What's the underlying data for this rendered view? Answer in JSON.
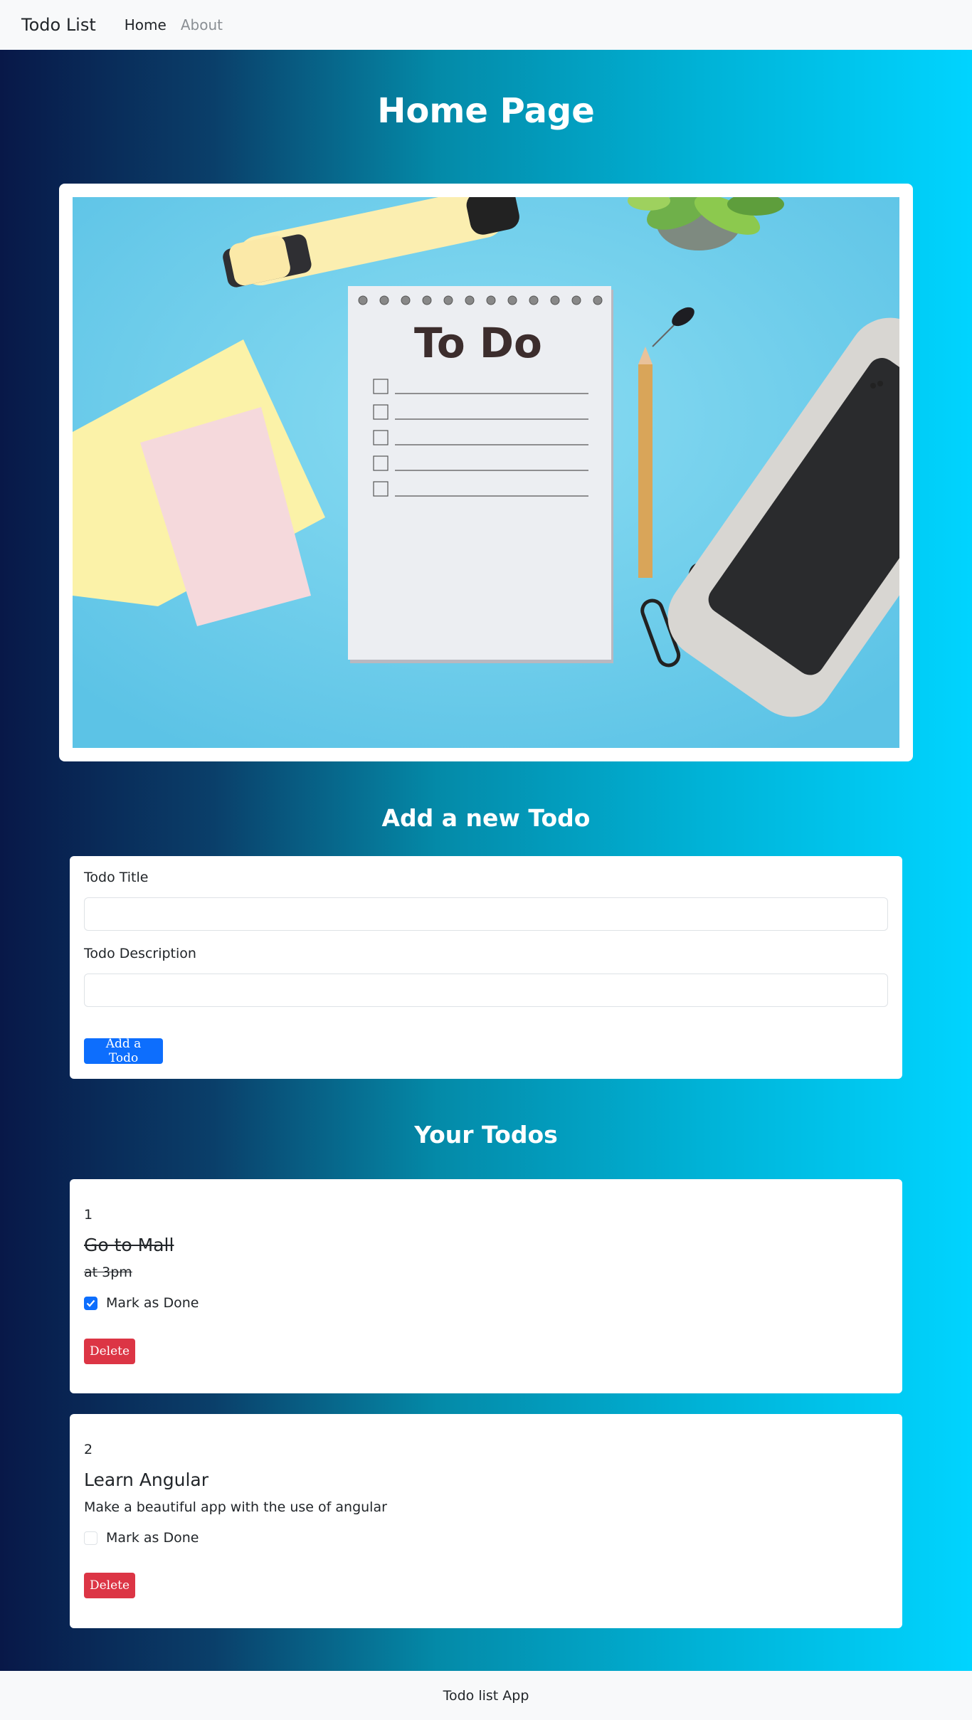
{
  "navbar": {
    "brand": "Todo List",
    "links": [
      "Home",
      "About"
    ]
  },
  "page": {
    "title": "Home Page",
    "hero_image": {
      "description_icon": "todo-notepad-image",
      "notepad_heading": "To Do"
    }
  },
  "add_form": {
    "section_title": "Add a new Todo",
    "title_label": "Todo Title",
    "title_value": "",
    "description_label": "Todo Description",
    "description_value": "",
    "submit_label": "Add a Todo"
  },
  "todos_section": {
    "title": "Your Todos",
    "items": [
      {
        "number": "1",
        "title": "Go to Mall",
        "description": "at 3pm",
        "done": true,
        "done_label": "Mark as Done",
        "delete_label": "Delete"
      },
      {
        "number": "2",
        "title": "Learn Angular",
        "description": "Make a beautiful app with the use of angular",
        "done": false,
        "done_label": "Mark as Done",
        "delete_label": "Delete"
      }
    ]
  },
  "footer": {
    "text": "Todo list App"
  },
  "colors": {
    "primary": "#0d6efd",
    "danger": "#dc3545",
    "gradient_start": "#081848",
    "gradient_end": "#00d4ff"
  }
}
